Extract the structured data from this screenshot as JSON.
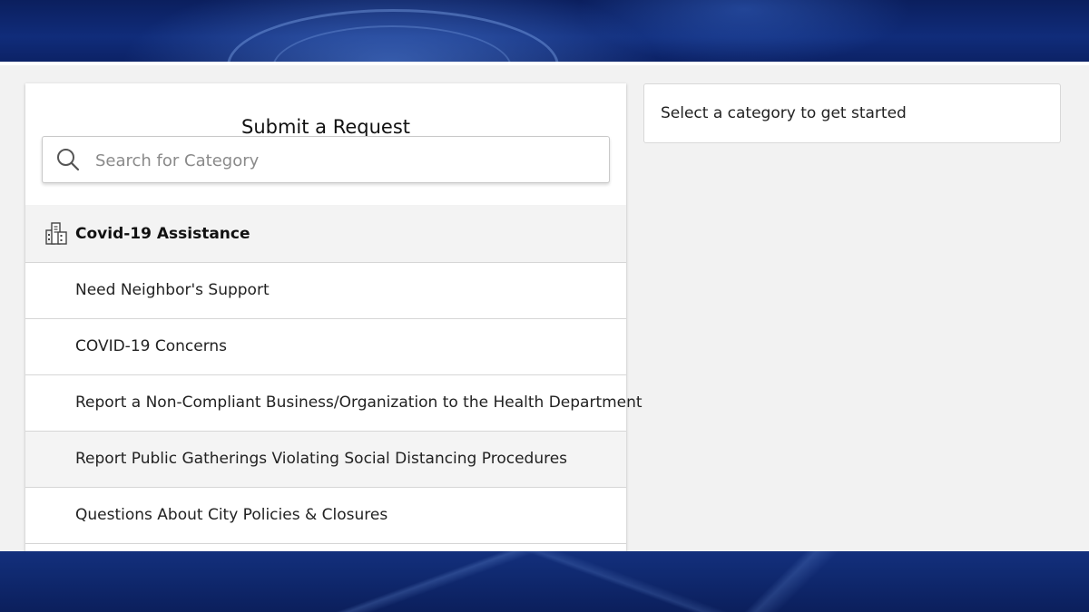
{
  "request_panel": {
    "title": "Submit a Request",
    "search": {
      "placeholder": "Search for Category",
      "value": ""
    },
    "category": {
      "label": "Covid-19 Assistance",
      "icon": "buildings-icon"
    },
    "items": [
      {
        "label": "Need Neighbor's Support"
      },
      {
        "label": "COVID-19 Concerns"
      },
      {
        "label": "Report a Non-Compliant Business/Organization to the Health Department"
      },
      {
        "label": "Report Public Gatherings Violating Social Distancing Procedures"
      },
      {
        "label": "Questions About City Policies & Closures"
      }
    ]
  },
  "detail_panel": {
    "prompt": "Select a category to get started"
  },
  "colors": {
    "background_blue": "#0b1f5e",
    "content_gray": "#f2f2f2",
    "panel_white": "#ffffff",
    "divider": "#d6d6d6"
  }
}
